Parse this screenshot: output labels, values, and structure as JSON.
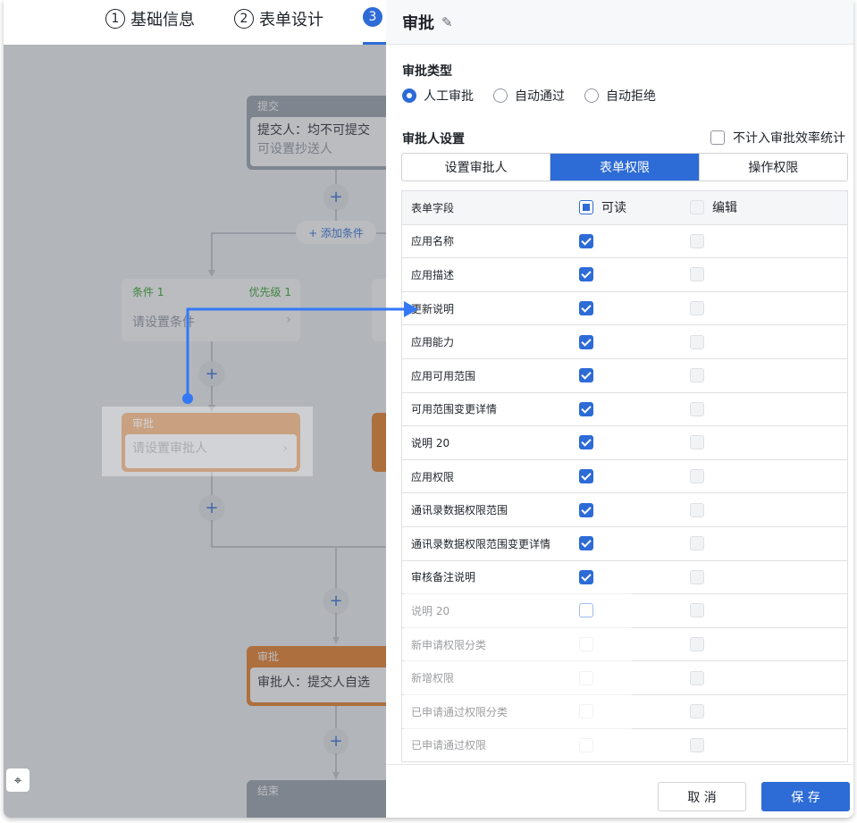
{
  "steps": [
    {
      "num": "1",
      "label": "基础信息"
    },
    {
      "num": "2",
      "label": "表单设计"
    },
    {
      "num": "3",
      "label": ""
    }
  ],
  "flow": {
    "submit_node": {
      "head": "提交",
      "line1": "提交人：均不可提交",
      "line2": "可设置抄送人"
    },
    "add_condition": "+ 添加条件",
    "condition_card": {
      "name": "条件 1",
      "priority": "优先级 1",
      "placeholder": "请设置条件"
    },
    "approve_node": {
      "head": "审批",
      "placeholder": "请设置审批人"
    },
    "approve_node2": {
      "head": "审批",
      "text": "审批人：提交人自选"
    },
    "end_node": {
      "head": "结束"
    },
    "plus": "+"
  },
  "panel": {
    "title": "审批",
    "approval_type_label": "审批类型",
    "approval_types": [
      {
        "label": "人工审批",
        "selected": true
      },
      {
        "label": "自动通过",
        "selected": false
      },
      {
        "label": "自动拒绝",
        "selected": false
      }
    ],
    "approver_settings_label": "审批人设置",
    "no_stat_label": "不计入审批效率统计",
    "tabs": [
      {
        "label": "设置审批人",
        "active": false
      },
      {
        "label": "表单权限",
        "active": true
      },
      {
        "label": "操作权限",
        "active": false
      }
    ],
    "table": {
      "col_field": "表单字段",
      "col_read": "可读",
      "col_edit": "编辑",
      "rows": [
        {
          "name": "应用名称",
          "read": "checked",
          "edit": "disabled"
        },
        {
          "name": "应用描述",
          "read": "checked",
          "edit": "disabled"
        },
        {
          "name": "更新说明",
          "read": "checked",
          "edit": "disabled"
        },
        {
          "name": "应用能力",
          "read": "checked",
          "edit": "disabled"
        },
        {
          "name": "应用可用范围",
          "read": "checked",
          "edit": "disabled"
        },
        {
          "name": "可用范围变更详情",
          "read": "checked",
          "edit": "disabled"
        },
        {
          "name": "说明 20",
          "read": "checked",
          "edit": "disabled"
        },
        {
          "name": "应用权限",
          "read": "checked",
          "edit": "disabled"
        },
        {
          "name": "通讯录数据权限范围",
          "read": "checked",
          "edit": "disabled"
        },
        {
          "name": "通讯录数据权限范围变更详情",
          "read": "checked",
          "edit": "disabled"
        },
        {
          "name": "审核备注说明",
          "read": "checked",
          "edit": "disabled"
        },
        {
          "name": "说明 20",
          "read": "focus",
          "edit": "disabled"
        },
        {
          "name": "新申请权限分类",
          "read": "light",
          "edit": "disabled"
        },
        {
          "name": "新增权限",
          "read": "light",
          "edit": "disabled"
        },
        {
          "name": "已申请通过权限分类",
          "read": "light",
          "edit": "disabled"
        },
        {
          "name": "已申请通过权限",
          "read": "light",
          "edit": "disabled"
        }
      ]
    },
    "cancel_label": "取 消",
    "save_label": "保 存"
  },
  "colors": {
    "primary": "#2d6bd6",
    "approve_orange": "#e97b1f",
    "submit_grey": "#9aa1ab",
    "condition_green": "#2ea121"
  }
}
